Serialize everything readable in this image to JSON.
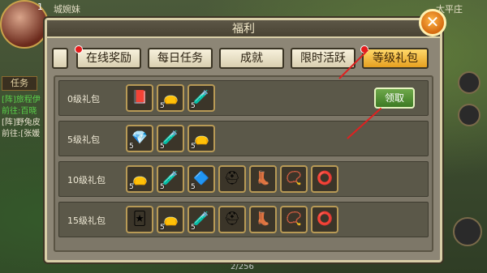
{
  "hud": {
    "level": "1",
    "player_name": "城婉妹",
    "right_location": "太平庄",
    "task_button": "任务",
    "page_counter": "2/256"
  },
  "chat": {
    "lines": [
      {
        "text": "[阵]旅程伊",
        "color": "green"
      },
      {
        "text": "前往:百晓",
        "color": "green"
      },
      {
        "text": "[阵]野兔皮",
        "color": "white"
      },
      {
        "text": "前往:[张媛",
        "color": "white"
      }
    ]
  },
  "panel": {
    "title": "福利",
    "close_label": "✕",
    "tabs": [
      {
        "label": "",
        "active": false,
        "dot": false
      },
      {
        "label": "在线奖励",
        "active": false,
        "dot": true
      },
      {
        "label": "每日任务",
        "active": false,
        "dot": false
      },
      {
        "label": "成就",
        "active": false,
        "dot": false
      },
      {
        "label": "限时活跃",
        "active": false,
        "dot": false
      },
      {
        "label": "等级礼包",
        "active": true,
        "dot": true
      }
    ],
    "rows": [
      {
        "label": "0级礼包",
        "claim_label": "领取",
        "items": [
          {
            "name": "red-book",
            "qty": "",
            "glyph": "📕"
          },
          {
            "name": "potion-bag",
            "qty": "5",
            "glyph": "👝"
          },
          {
            "name": "blue-flask",
            "qty": "5",
            "glyph": "🧪"
          }
        ]
      },
      {
        "label": "5级礼包",
        "claim_label": "",
        "items": [
          {
            "name": "teal-crystal",
            "qty": "5",
            "glyph": "💎"
          },
          {
            "name": "blue-flask",
            "qty": "5",
            "glyph": "🧪"
          },
          {
            "name": "potion-bag",
            "qty": "5",
            "glyph": "👝"
          }
        ]
      },
      {
        "label": "10级礼包",
        "claim_label": "",
        "items": [
          {
            "name": "potion-bag",
            "qty": "5",
            "glyph": "👝"
          },
          {
            "name": "blue-flask",
            "qty": "5",
            "glyph": "🧪"
          },
          {
            "name": "blue-gem-pile",
            "qty": "5",
            "glyph": "🔷"
          },
          {
            "name": "golden-helmet",
            "qty": "",
            "glyph": "⛑"
          },
          {
            "name": "leather-boots",
            "qty": "",
            "glyph": "👢"
          },
          {
            "name": "necklace",
            "qty": "",
            "glyph": "📿"
          },
          {
            "name": "green-ring",
            "qty": "",
            "glyph": "⭕"
          }
        ]
      },
      {
        "label": "15级礼包",
        "claim_label": "",
        "items": [
          {
            "name": "silver-card",
            "qty": "",
            "glyph": "🃏"
          },
          {
            "name": "potion-bag",
            "qty": "5",
            "glyph": "👝"
          },
          {
            "name": "blue-flask",
            "qty": "5",
            "glyph": "🧪"
          },
          {
            "name": "golden-helmet",
            "qty": "",
            "glyph": "⛑"
          },
          {
            "name": "leather-boots",
            "qty": "",
            "glyph": "👢"
          },
          {
            "name": "necklace",
            "qty": "",
            "glyph": "📿"
          },
          {
            "name": "green-ring",
            "qty": "",
            "glyph": "⭕"
          }
        ]
      }
    ]
  },
  "colors": {
    "active_tab": "#e6a020",
    "notification_dot": "#e51c1c",
    "claim_button": "#3d7a24",
    "annotation_arrow": "#e02020"
  }
}
